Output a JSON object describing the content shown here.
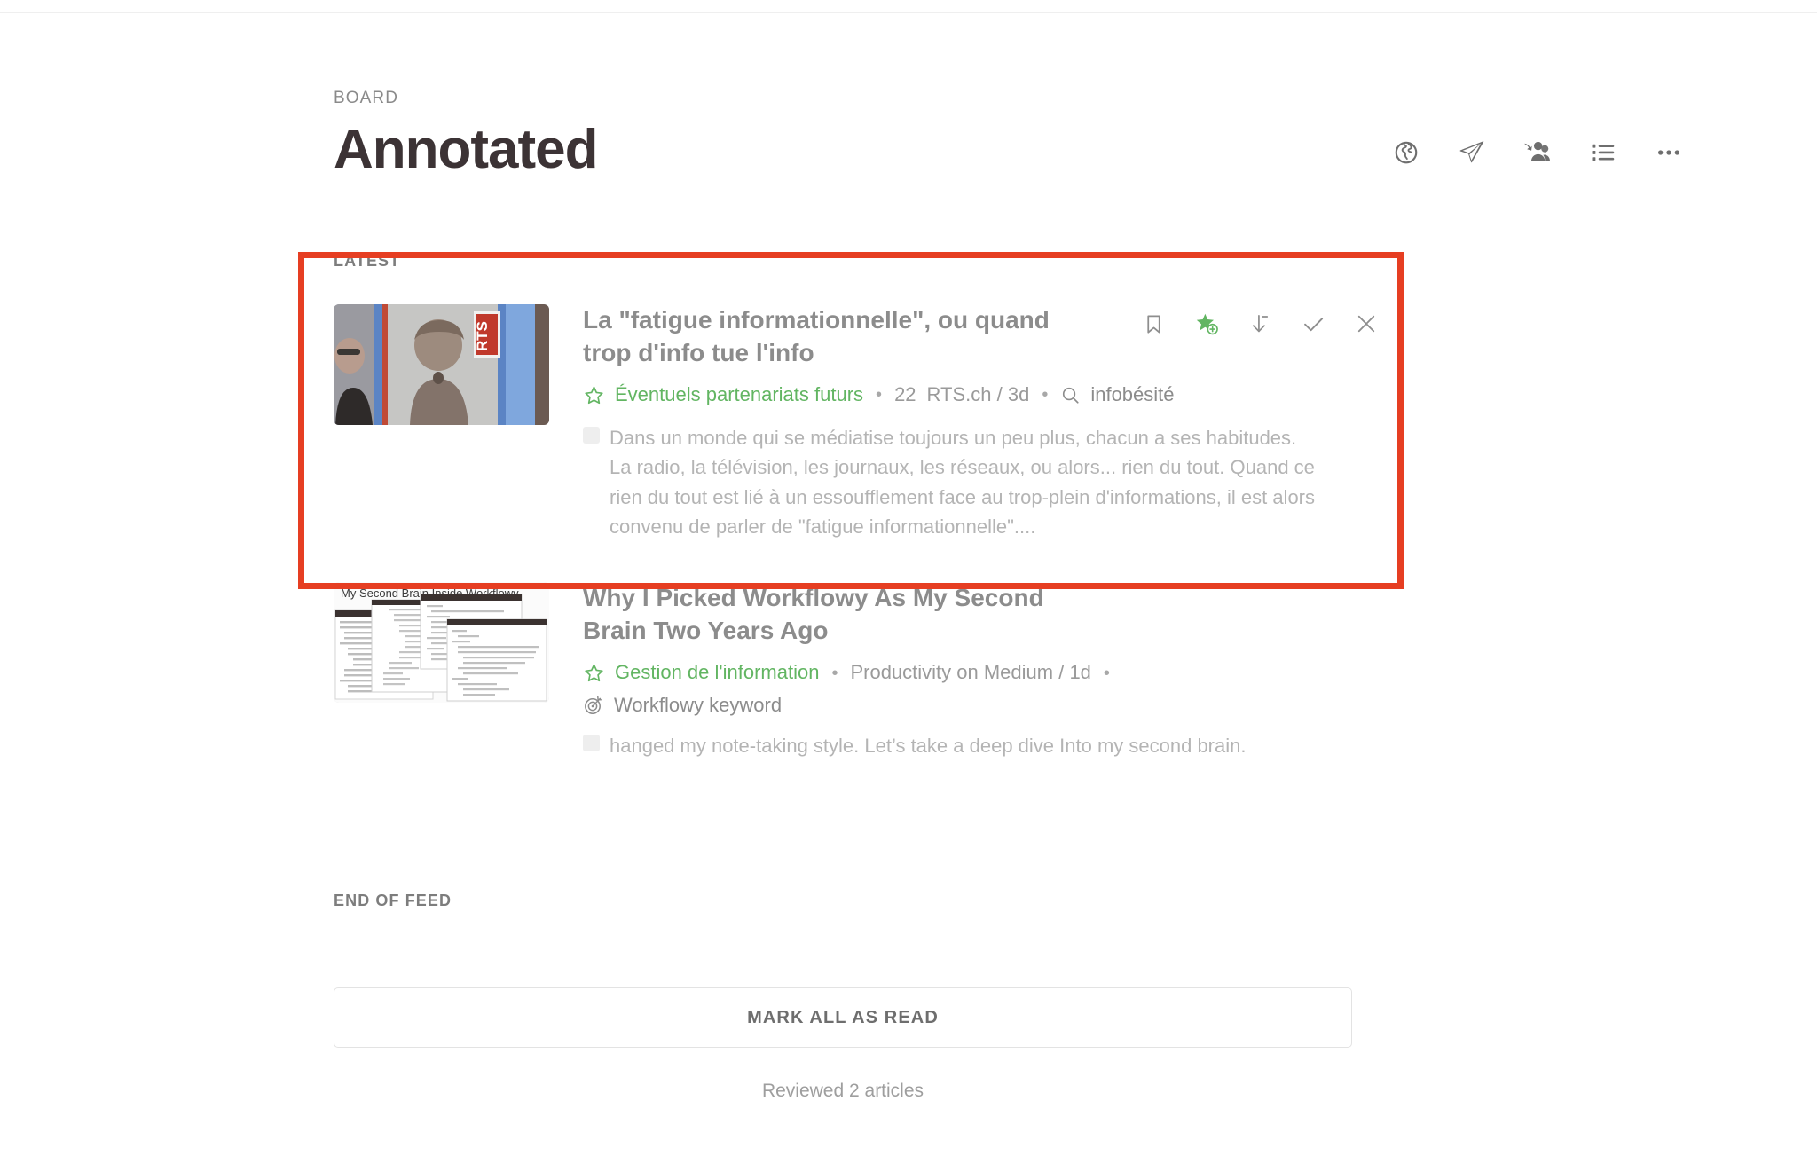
{
  "header": {
    "eyebrow": "BOARD",
    "title": "Annotated",
    "actions": [
      {
        "name": "globe-icon",
        "label": "Public board"
      },
      {
        "name": "send-icon",
        "label": "Send"
      },
      {
        "name": "add-people-icon",
        "label": "Invite collaborators"
      },
      {
        "name": "list-view-icon",
        "label": "List view"
      },
      {
        "name": "more-options-icon",
        "label": "More"
      }
    ]
  },
  "feed": {
    "section_label": "LATEST",
    "end_of_feed_label": "END OF FEED",
    "mark_all_read_label": "MARK ALL AS READ",
    "reviewed_text": "Reviewed 2 articles",
    "articles": [
      {
        "title": "La \"fatigue informationnelle\", ou quand trop d'info tue l'info",
        "tag": "Éventuels partenariats futurs",
        "separator": "•",
        "count": "22",
        "source": "RTS.ch / 3d",
        "keyword": "infobésité",
        "keyword_icon": "search-icon",
        "summary": "Dans un monde qui se médiatise toujours un peu plus, chacun a ses habitudes. La radio, la télévision, les journaux, les réseaux, ou alors... rien du tout. Quand ce rien du tout est lié à un essoufflement face au trop-plein d'informations, il est alors convenu de parler de \"fatigue informationnelle\"....",
        "thumbnail_alt": "RTS television news still",
        "actions": [
          {
            "name": "bookmark-icon",
            "label": "Bookmark"
          },
          {
            "name": "star-plus-icon",
            "label": "Add to board"
          },
          {
            "name": "download-icon",
            "label": "Save"
          },
          {
            "name": "check-icon",
            "label": "Mark as read"
          },
          {
            "name": "close-icon",
            "label": "Dismiss"
          }
        ]
      },
      {
        "title": "Why I Picked Workflowy As My Second Brain Two Years Ago",
        "tag": "Gestion de l'information",
        "separator": "•",
        "source": "Productivity on Medium / 1d",
        "trailing_separator": "•",
        "keyword": "Workflowy keyword",
        "keyword_icon": "target-icon",
        "summary": "hanged my note-taking style. Let’s take a deep dive Into my second brain.",
        "thumbnail_alt": "My Second Brain Inside Workflowy",
        "thumbnail_caption": "My Second Brain Inside Workflowy"
      }
    ]
  },
  "colors": {
    "accent_green": "#62b562",
    "highlight_red": "#e63e22",
    "title_dark": "#3c3335",
    "text_gray": "#8c8c8c"
  }
}
